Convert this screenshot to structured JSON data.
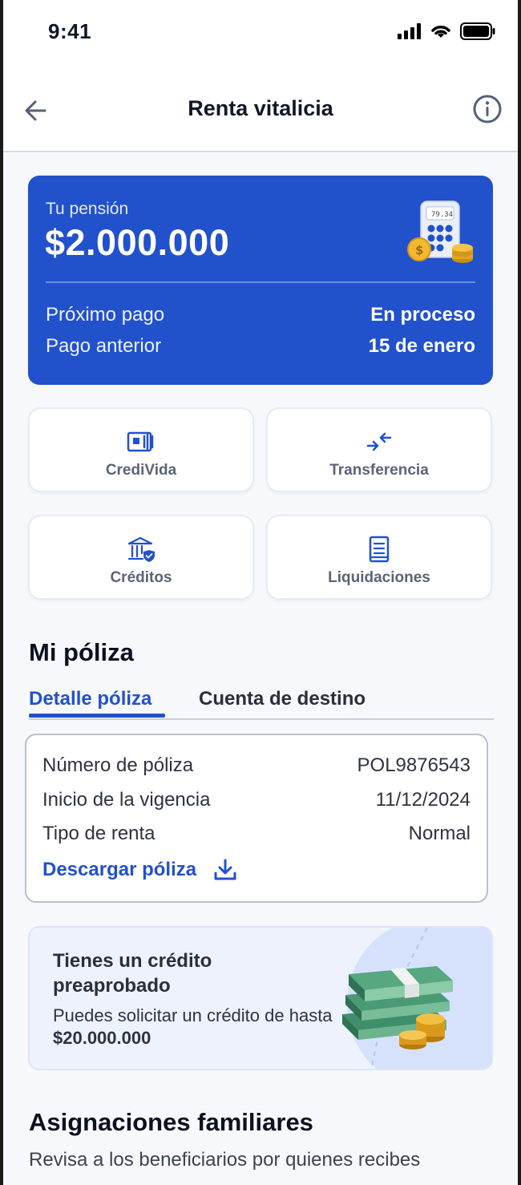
{
  "status_bar": {
    "time": "9:41"
  },
  "header": {
    "title": "Renta vitalicia"
  },
  "pension_card": {
    "label": "Tu pensión",
    "amount": "$2.000.000",
    "calculator_display": "79.34",
    "rows": [
      {
        "label": "Próximo pago",
        "value": "En proceso"
      },
      {
        "label": "Pago anterior",
        "value": "15 de enero"
      }
    ]
  },
  "actions": [
    {
      "label": "CrediVida",
      "icon": "card-icon"
    },
    {
      "label": "Transferencia",
      "icon": "transfer-icon"
    },
    {
      "label": "Créditos",
      "icon": "bank-shield-icon"
    },
    {
      "label": "Liquidaciones",
      "icon": "document-icon"
    }
  ],
  "policy": {
    "section_title": "Mi póliza",
    "tabs": [
      {
        "label": "Detalle póliza",
        "active": true
      },
      {
        "label": "Cuenta de destino",
        "active": false
      }
    ],
    "rows": [
      {
        "label": "Número de póliza",
        "value": "POL9876543"
      },
      {
        "label": "Inicio de la vigencia",
        "value": "11/12/2024"
      },
      {
        "label": "Tipo de renta",
        "value": "Normal"
      }
    ],
    "download_label": "Descargar póliza"
  },
  "promo": {
    "title": "Tienes un crédito preaprobado",
    "text_prefix": "Puedes solicitar un crédito de hasta ",
    "amount": "$20.000.000"
  },
  "family": {
    "title": "Asignaciones familiares",
    "text": "Revisa a los beneficiarios por quienes recibes"
  },
  "colors": {
    "primary": "#2251cc",
    "background": "#f7f8fb"
  }
}
